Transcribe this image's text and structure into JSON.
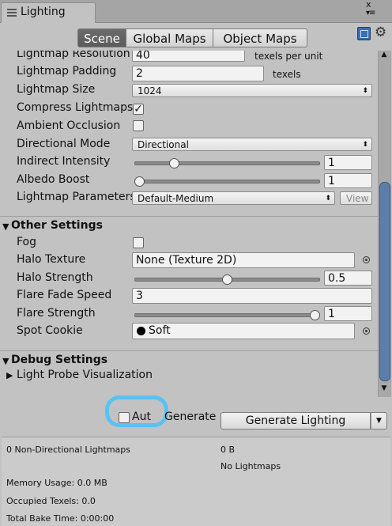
{
  "window": {
    "tab_title": "Lighting",
    "close_glyph": "x",
    "menu_glyph": "▾≡"
  },
  "toolbar": {
    "tabs": [
      "Scene",
      "Global Maps",
      "Object Maps"
    ],
    "active": 0
  },
  "icons": {
    "help": "help-book-icon",
    "settings": "gear-icon",
    "accent": "#5d7ea8",
    "highlight": "#58c2f4"
  },
  "lightmapping": {
    "resolution": {
      "label": "Lightmap Resolution",
      "value": "40",
      "unit": "texels per unit"
    },
    "padding": {
      "label": "Lightmap Padding",
      "value": "2",
      "unit": "texels"
    },
    "size": {
      "label": "Lightmap Size",
      "value": "1024"
    },
    "compress": {
      "label": "Compress Lightmaps",
      "checked": true
    },
    "ao": {
      "label": "Ambient Occlusion",
      "checked": false
    },
    "directional": {
      "label": "Directional Mode",
      "value": "Directional"
    },
    "indirect": {
      "label": "Indirect Intensity",
      "value": "1",
      "fraction": 0.2
    },
    "albedo": {
      "label": "Albedo Boost",
      "value": "1",
      "fraction": 0.0
    },
    "params": {
      "label": "Lightmap Parameters",
      "value": "Default-Medium",
      "button": "View"
    }
  },
  "other": {
    "title": "Other Settings",
    "fog": {
      "label": "Fog",
      "checked": false
    },
    "halo_texture": {
      "label": "Halo Texture",
      "value": "None (Texture 2D)"
    },
    "halo_strength": {
      "label": "Halo Strength",
      "value": "0.5",
      "fraction": 0.5
    },
    "flare_fade": {
      "label": "Flare Fade Speed",
      "value": "3"
    },
    "flare_strength": {
      "label": "Flare Strength",
      "value": "1",
      "fraction": 1.0
    },
    "spot_cookie": {
      "label": "Spot Cookie",
      "value": "Soft"
    }
  },
  "debug": {
    "title": "Debug Settings",
    "probe_vis": "Light Probe Visualization"
  },
  "generate": {
    "auto_label": "Aut",
    "auto_checked": false,
    "label": "Generate",
    "button": "Generate Lighting"
  },
  "stats": {
    "lightmaps": "0 Non-Directional Lightmaps",
    "bytes": "0 B",
    "no_lightmaps": "No Lightmaps",
    "memory": "Memory Usage: 0.0 MB",
    "texels": "Occupied Texels: 0.0",
    "bake_time": "Total Bake Time: 0:00:00"
  }
}
